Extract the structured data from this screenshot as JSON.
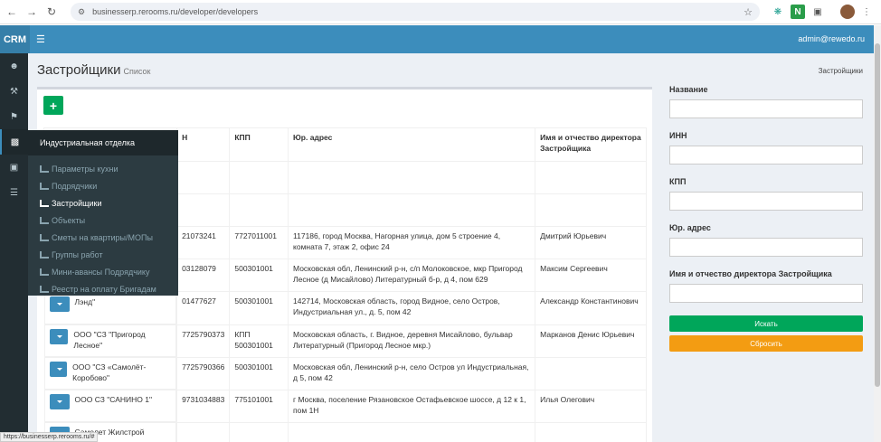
{
  "browser": {
    "url": "businesserp.rerooms.ru/developer/developers",
    "status_url": "https://businesserp.rerooms.ru/#"
  },
  "header": {
    "brand": "CRM",
    "user": "admin@rewedo.ru"
  },
  "page": {
    "title": "Застройщики",
    "subtitle": "Список",
    "breadcrumb": "Застройщики"
  },
  "flyout": {
    "title": "Индустриальная отделка",
    "items": [
      {
        "label": "Параметры кухни"
      },
      {
        "label": "Подрядчики"
      },
      {
        "label": "Застройщики"
      },
      {
        "label": "Объекты"
      },
      {
        "label": "Сметы на квартиры/МОПы"
      },
      {
        "label": "Группы работ"
      },
      {
        "label": "Мини-авансы Подрядчику"
      },
      {
        "label": "Реестр на оплату Бригадам"
      }
    ]
  },
  "table": {
    "columns": [
      "",
      "Н",
      "КПП",
      "Юр. адрес",
      "Имя и отчество директора Застройщика"
    ],
    "rows": [
      {
        "name": "",
        "inn": "",
        "kpp": "",
        "address": "",
        "director": ""
      },
      {
        "name": "",
        "inn": "",
        "kpp": "",
        "address": "",
        "director": ""
      },
      {
        "name": "",
        "inn": "21073241",
        "kpp": "7727011001",
        "address": "117186, город Москва, Нагорная улица, дом 5 строение 4, комната 7, этаж 2, офис 24",
        "director": "Дмитрий Юрьевич"
      },
      {
        "name": "",
        "inn": "03128079",
        "kpp": "500301001",
        "address": "Московская обл, Ленинский р-н, с/п Молоковское, мкр Пригород Лесное (д Мисайлово) Литературный б-р, д 4, пом 629",
        "director": "Максим Сергеевич"
      },
      {
        "name": "Лэнд\"",
        "inn": "01477627",
        "kpp": "500301001",
        "address": "142714, Московская область, город Видное, село Остров, Индустриальная ул., д. 5, пом 42",
        "director": "Александр Константинович"
      },
      {
        "name": "ООО \"СЗ \"Пригород Лесное\"",
        "inn": "7725790373",
        "kpp": "КПП 500301001",
        "address": "Московская область, г. Видное, деревня Мисайлово, бульвар Литературный (Пригород Лесное мкр.)",
        "director": "Марканов Денис Юрьевич"
      },
      {
        "name": "ООО \"СЗ «Самолёт-Коробово\"",
        "inn": "7725790366",
        "kpp": "500301001",
        "address": "Московская обл, Ленинский р-н, село Остров ул Индустриальная, д 5, пом 42",
        "director": ""
      },
      {
        "name": "ООО СЗ \"САНИНО 1\"",
        "inn": "9731034883",
        "kpp": "775101001",
        "address": "г Москва, поселение Рязановское Остафьевское шоссе, д 12 к 1, пом 1Н",
        "director": "Илья Олегович"
      },
      {
        "name": "Самолет Жилстрой",
        "inn": "",
        "kpp": "",
        "address": "",
        "director": ""
      }
    ]
  },
  "filters": {
    "name_label": "Название",
    "inn_label": "ИНН",
    "kpp_label": "КПП",
    "address_label": "Юр. адрес",
    "director_label": "Имя и отчество директора Застройщика",
    "search_label": "Искать",
    "reset_label": "Сбросить"
  },
  "colors": {
    "header": "#3c8dbc",
    "sidebar": "#222d32",
    "green": "#00a65a",
    "orange": "#f39c12"
  }
}
